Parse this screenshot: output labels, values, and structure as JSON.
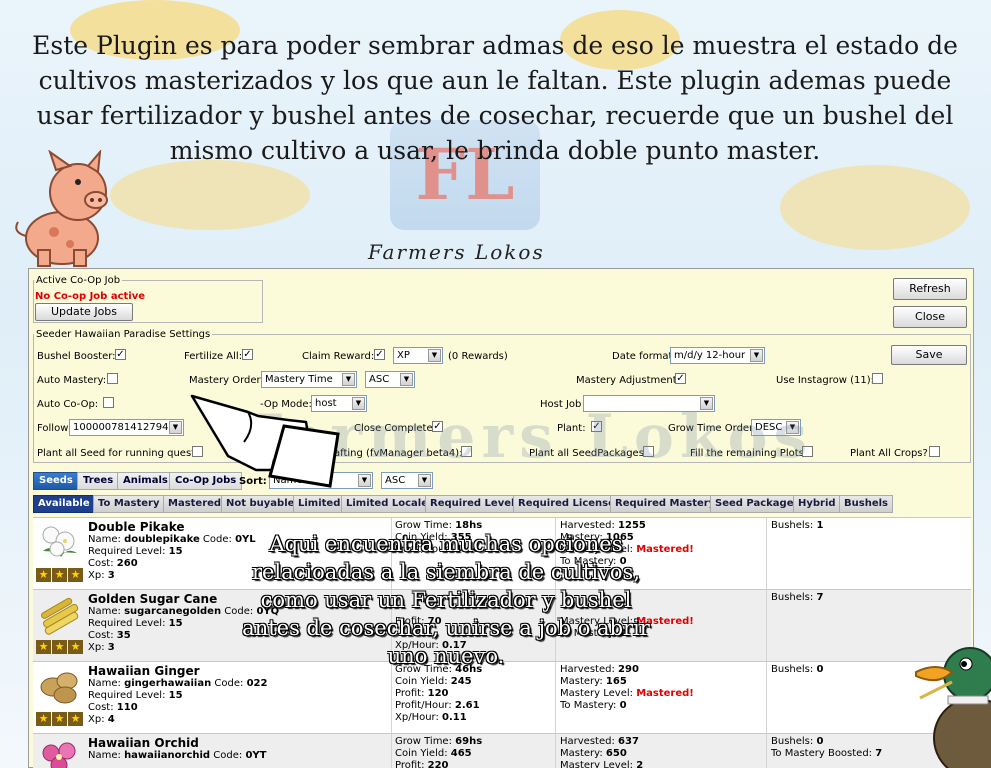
{
  "banner": {
    "intro_text": "Este Plugin es para  poder sembrar admas de eso le muestra el estado de cultivos masterizados y los que aun le faltan. Este plugin ademas puede usar fertilizador  y bushel antes de cosechar, recuerde que un bushel del mismo cultivo a usar, le brinda doble punto master.",
    "logo_text": "FL",
    "farmers_title": "Farmers Lokos"
  },
  "watermark": "Farmers Lokos",
  "overlay_text": "Aqui encuentra muchas opciones relacioadas a la siembra de  cultivos, como usar un Fertilizador y bushel antes de cosechar, unirse a job o abrir uno nuevo.",
  "coop": {
    "legend": "Active Co-Op Job",
    "status": "No Co-op Job active",
    "update_label": "Update Jobs"
  },
  "buttons": {
    "refresh": "Refresh",
    "close": "Close",
    "save": "Save"
  },
  "settings": {
    "legend": "Seeder Hawaiian Paradise Settings",
    "bushel_booster": "Bushel Booster:",
    "fertilize_all": "Fertilize All:",
    "claim_reward": "Claim Reward:",
    "claim_reward_value": "XP",
    "rewards_count": "(0 Rewards)",
    "date_format": "Date format:",
    "date_format_value": "m/d/y 12-hour",
    "auto_mastery": "Auto Mastery:",
    "mastery_order": "Mastery Order:",
    "mastery_order_value": "Mastery Time",
    "mastery_order_dir": "ASC",
    "mastery_adjustment": "Mastery Adjustment:",
    "use_instagrow": "Use Instagrow (11):",
    "auto_coop": "Auto Co-Op:",
    "coop_mode": "Co-Op Mode:",
    "coop_mode_partial": "-Op Mode:",
    "coop_mode_value": "host",
    "host_job": "Host Job",
    "host_job_value": "",
    "follow": "Follow",
    "follow_value": "100000781412794",
    "close_complete": "Close Complete:",
    "plant": "Plant:",
    "grow_time_order": "Grow Time Order",
    "grow_time_order_value": "DESC",
    "plant_all_seed": "Plant all Seed for running quest:",
    "crafting_partial": "afting (fvManager beta4):",
    "plant_all_seedpackages": "Plant all SeedPackages:",
    "fill_remaining": "Fill the remaining Plots:",
    "plant_all_crops": "Plant All Crops?"
  },
  "type_tabs": [
    "Seeds",
    "Trees",
    "Animals",
    "Co-Op Jobs"
  ],
  "sort": {
    "label": "Sort:",
    "value": "Name",
    "dir": "ASC"
  },
  "filter_tabs": [
    "Available",
    "To Mastery",
    "Mastered",
    "Not buyable",
    "Limited",
    "Limited Locale",
    "Required Level",
    "Required License",
    "Required Mastery",
    "Seed Package",
    "Hybrid",
    "Bushels"
  ],
  "crops": [
    {
      "title": "Double Pikake",
      "name_label": "Name:",
      "name": "doublepikake",
      "code_label": "Code:",
      "code": "0YL",
      "level_label": "Required Level:",
      "level": "15",
      "cost_label": "Cost:",
      "cost": "260",
      "xp_label": "Xp:",
      "xp": "3",
      "grow_time": "Grow Time:",
      "grow_value": "18hs",
      "coin_yield": "Coin Yield:",
      "coin_value": "355",
      "profit": "Profit:",
      "profit_value": "",
      "profit_hour": "Profit/Hour:",
      "profit_hour_value": "4.46",
      "xp_hour": "Xp/Hour:",
      "xp_hour_value": "",
      "harvested": "Harvested:",
      "harvested_value": "1255",
      "mastery": "Mastery:",
      "mastery_value": "1065",
      "mastery_level": "Mastery Level:",
      "mastery_level_value": "Mastered!",
      "to_mastery": "To Mastery:",
      "to_mastery_value": "0",
      "bushels": "Bushels:",
      "bushels_value": "1",
      "extra": "",
      "extra_value": "",
      "icon": "white-flower-icon",
      "stars": 3
    },
    {
      "title": "Golden Sugar Cane",
      "name_label": "Name:",
      "name": "sugarcanegolden",
      "code_label": "Code:",
      "code": "0YQ",
      "level_label": "Required Level:",
      "level": "15",
      "cost_label": "Cost:",
      "cost": "35",
      "xp_label": "Xp:",
      "xp": "3",
      "grow_time": "",
      "grow_value": "",
      "coin_yield": "",
      "coin_value": "",
      "profit": "Profit:",
      "profit_value": "70",
      "profit_hour": "Profit/Hour:",
      "profit_hour_value": "",
      "xp_hour": "Xp/Hour:",
      "xp_hour_value": "0.17",
      "harvested": "",
      "harvested_value": "",
      "mastery": "",
      "mastery_value": "",
      "mastery_level": "Mastery Level:",
      "mastery_level_value": "Mastered!",
      "to_mastery": "To Mastery:",
      "to_mastery_value": "0",
      "bushels": "Bushels:",
      "bushels_value": "7",
      "extra": "",
      "extra_value": "",
      "icon": "sugar-cane-icon",
      "stars": 3
    },
    {
      "title": "Hawaiian Ginger",
      "name_label": "Name:",
      "name": "gingerhawaiian",
      "code_label": "Code:",
      "code": "022",
      "level_label": "Required Level:",
      "level": "15",
      "cost_label": "Cost:",
      "cost": "110",
      "xp_label": "Xp:",
      "xp": "4",
      "grow_time": "Grow Time:",
      "grow_value": "46hs",
      "coin_yield": "Coin Yield:",
      "coin_value": "245",
      "profit": "Profit:",
      "profit_value": "120",
      "profit_hour": "Profit/Hour:",
      "profit_hour_value": "2.61",
      "xp_hour": "Xp/Hour:",
      "xp_hour_value": "0.11",
      "harvested": "Harvested:",
      "harvested_value": "290",
      "mastery": "Mastery:",
      "mastery_value": "165",
      "mastery_level": "Mastery Level:",
      "mastery_level_value": "Mastered!",
      "to_mastery": "To Mastery:",
      "to_mastery_value": "0",
      "bushels": "Bushels:",
      "bushels_value": "0",
      "extra": "",
      "extra_value": "",
      "icon": "ginger-root-icon",
      "stars": 3
    },
    {
      "title": "Hawaiian Orchid",
      "name_label": "Name:",
      "name": "hawaiianorchid",
      "code_label": "Code:",
      "code": "0YT",
      "level_label": "",
      "level": "",
      "cost_label": "",
      "cost": "",
      "xp_label": "",
      "xp": "",
      "grow_time": "Grow Time:",
      "grow_value": "69hs",
      "coin_yield": "Coin Yield:",
      "coin_value": "465",
      "profit": "Profit:",
      "profit_value": "220",
      "profit_hour": "",
      "profit_hour_value": "",
      "xp_hour": "",
      "xp_hour_value": "",
      "harvested": "Harvested:",
      "harvested_value": "637",
      "mastery": "Mastery:",
      "mastery_value": "650",
      "mastery_level": "Mastery Level:",
      "mastery_level_value": "2",
      "to_mastery": "",
      "to_mastery_value": "",
      "bushels": "Bushels:",
      "bushels_value": "0",
      "extra": "To Mastery Boosted:",
      "extra_value": "7",
      "icon": "orchid-flower-icon",
      "stars": 0
    }
  ]
}
